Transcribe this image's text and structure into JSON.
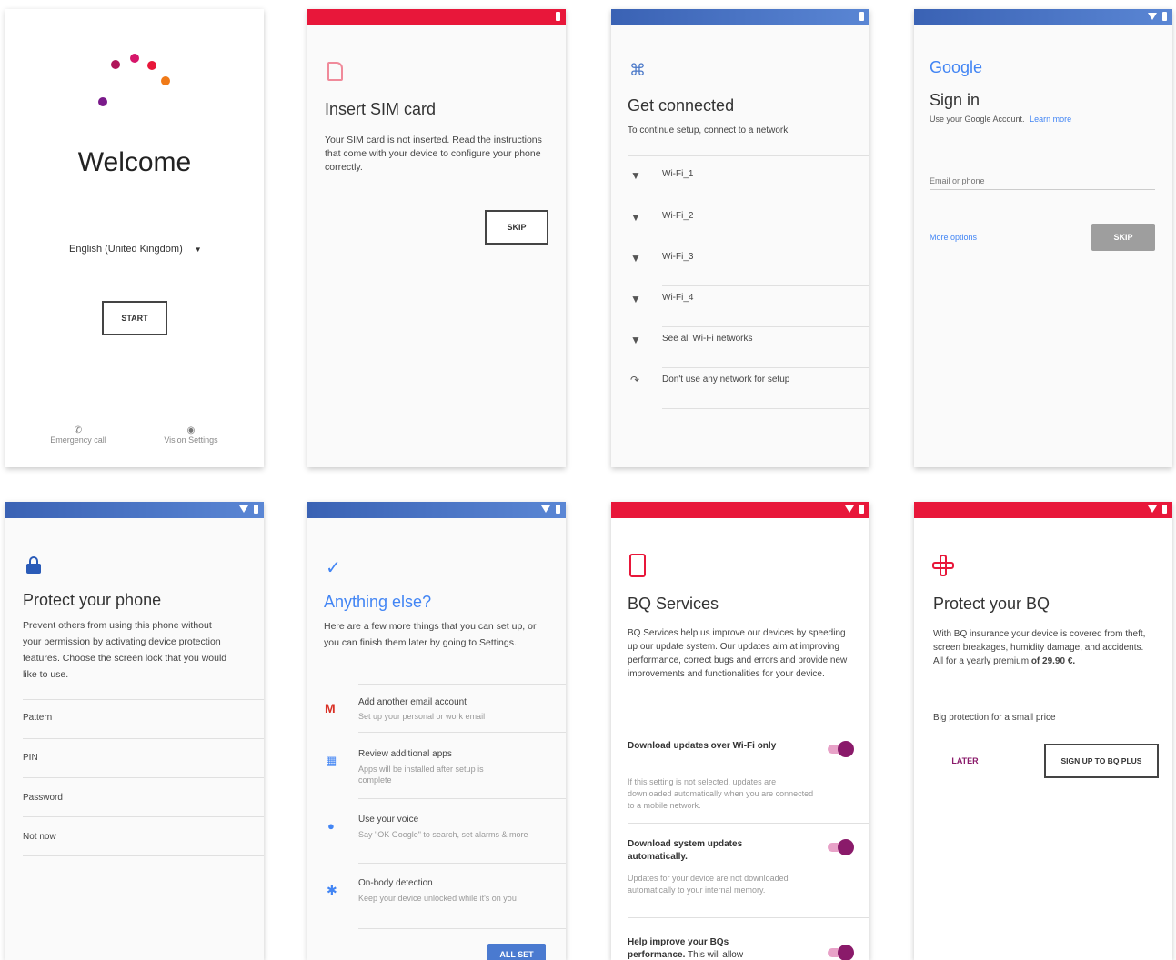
{
  "welcome": {
    "title": "Welcome",
    "language": "English (United Kingdom)",
    "start_label": "START",
    "emergency_label": "Emergency call",
    "vision_label": "Vision Settings"
  },
  "sim": {
    "title": "Insert SIM card",
    "body": "Your SIM card is not inserted. Read the instructions that come with your device to configure your phone correctly.",
    "skip_label": "SKIP"
  },
  "connect": {
    "title": "Get connected",
    "subtitle": "To continue setup, connect to a network",
    "networks": [
      "Wi-Fi_1",
      "Wi-Fi_2",
      "Wi-Fi_3",
      "Wi-Fi_4"
    ],
    "see_all": "See all Wi-Fi networks",
    "no_network": "Don't use any network for setup"
  },
  "google": {
    "logo": "Google",
    "title": "Sign in",
    "subtitle": "Use your Google Account.",
    "learn_more": "Learn more",
    "email_placeholder": "Email or phone",
    "more_options": "More options",
    "skip_label": "SKIP"
  },
  "protect": {
    "title": "Protect your phone",
    "body": "Prevent others from using this phone without your permission by activating device protection features. Choose the screen lock that you would like to use.",
    "options": [
      "Pattern",
      "PIN",
      "Password",
      "Not now"
    ]
  },
  "anything": {
    "title": "Anything else?",
    "body": "Here are a few more things that you can set up, or you can finish them later by going to Settings.",
    "items": [
      {
        "title": "Add another email account",
        "sub": "Set up your personal or work email"
      },
      {
        "title": "Review additional apps",
        "sub": "Apps will be installed after setup is complete"
      },
      {
        "title": "Use your voice",
        "sub": "Say \"OK Google\" to search, set alarms & more"
      },
      {
        "title": "On-body detection",
        "sub": "Keep your device unlocked while it's on you"
      }
    ],
    "all_set_label": "ALL SET"
  },
  "bq": {
    "title": "BQ Services",
    "body": "BQ Services help us improve our devices by speeding up our update system. Our updates aim at improving performance, correct bugs and errors and provide new improvements and functionalities for your device.",
    "toggles": [
      {
        "title": "Download updates over Wi-Fi only",
        "desc": "If this setting is not selected, updates are downloaded automatically when you are connected to a mobile network."
      },
      {
        "title": "Download system updates automatically.",
        "desc": "Updates for your device are not downloaded automatically to your internal memory."
      },
      {
        "title": "Help improve your BQs performance.",
        "desc": "This will allow"
      }
    ]
  },
  "protectbq": {
    "title": "Protect your BQ",
    "body": "With BQ insurance your device is covered from theft, screen breakages, humidity damage, and accidents. All for a yearly premium",
    "price": "of 29.90 €.",
    "tagline": "Big protection for a small price",
    "later_label": "LATER",
    "signup_label": "SIGN UP TO BQ PLUS"
  },
  "colors": {
    "red_bar": "#e8173a",
    "blue_bar": "#3a62b4",
    "google_blue": "#4285f4",
    "bq_magenta": "#8a1a6a"
  }
}
